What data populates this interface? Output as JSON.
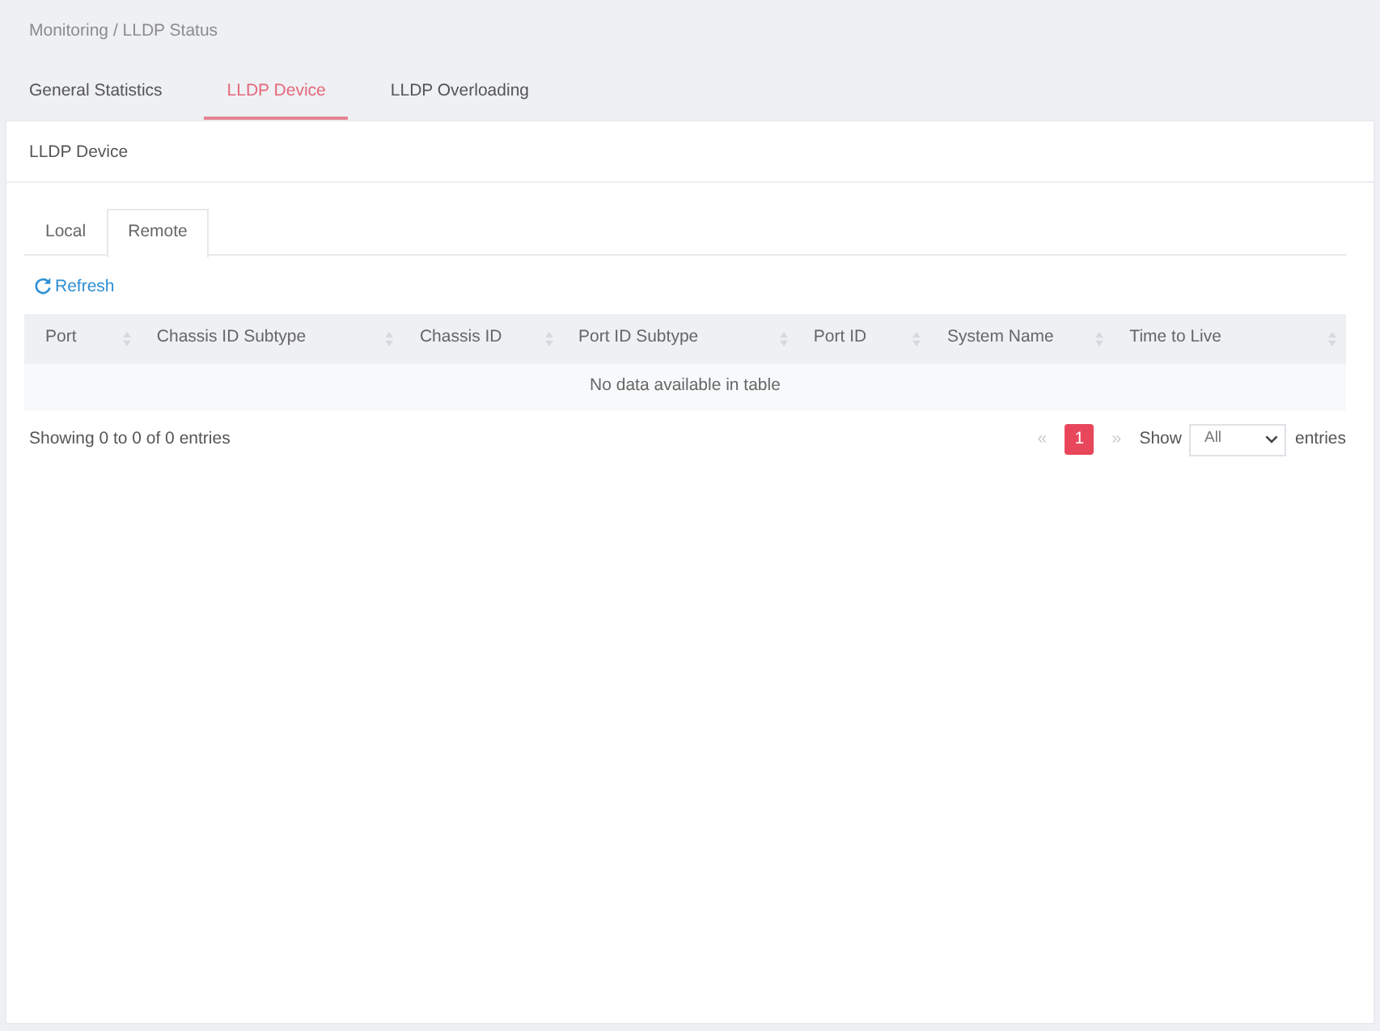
{
  "breadcrumb": "Monitoring / LLDP Status",
  "tabs": [
    {
      "label": "General Statistics",
      "selected": false
    },
    {
      "label": "LLDP Device",
      "selected": true
    },
    {
      "label": "LLDP Overloading",
      "selected": false
    }
  ],
  "panel": {
    "title": "LLDP Device",
    "subtabs": [
      {
        "label": "Local",
        "selected": false
      },
      {
        "label": "Remote",
        "selected": true
      }
    ],
    "refresh": {
      "label": "Refresh"
    },
    "table": {
      "columns": [
        "Port",
        "Chassis ID Subtype",
        "Chassis ID",
        "Port ID Subtype",
        "Port ID",
        "System Name",
        "Time to Live"
      ],
      "empty_message": "No data available in table"
    },
    "info": "Showing 0 to 0 of 0 entries",
    "pagination": {
      "previous": {
        "label": "«",
        "disabled": true
      },
      "pages": [
        {
          "label": "1",
          "selected": true
        }
      ],
      "next": {
        "label": "»",
        "disabled": true
      }
    },
    "page_length": {
      "label": "Show",
      "value": "All",
      "suffix": "entries"
    }
  }
}
